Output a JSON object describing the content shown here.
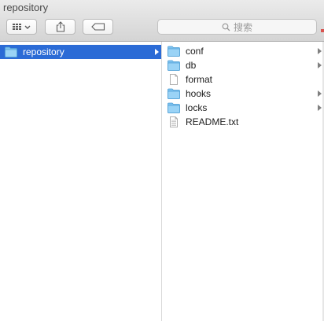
{
  "window": {
    "title": "repository"
  },
  "toolbar": {
    "search_placeholder": "搜索"
  },
  "column1": {
    "items": [
      {
        "label": "repository",
        "type": "folder",
        "selected": true,
        "has_children": true
      }
    ]
  },
  "column2": {
    "items": [
      {
        "label": "conf",
        "type": "folder",
        "has_children": true
      },
      {
        "label": "db",
        "type": "folder",
        "has_children": true
      },
      {
        "label": "format",
        "type": "file",
        "has_children": false
      },
      {
        "label": "hooks",
        "type": "folder",
        "has_children": true
      },
      {
        "label": "locks",
        "type": "folder",
        "has_children": true
      },
      {
        "label": "README.txt",
        "type": "text-file",
        "has_children": false
      }
    ]
  },
  "colors": {
    "selection": "#2b6bd6",
    "folder": "#7cc2ef"
  }
}
